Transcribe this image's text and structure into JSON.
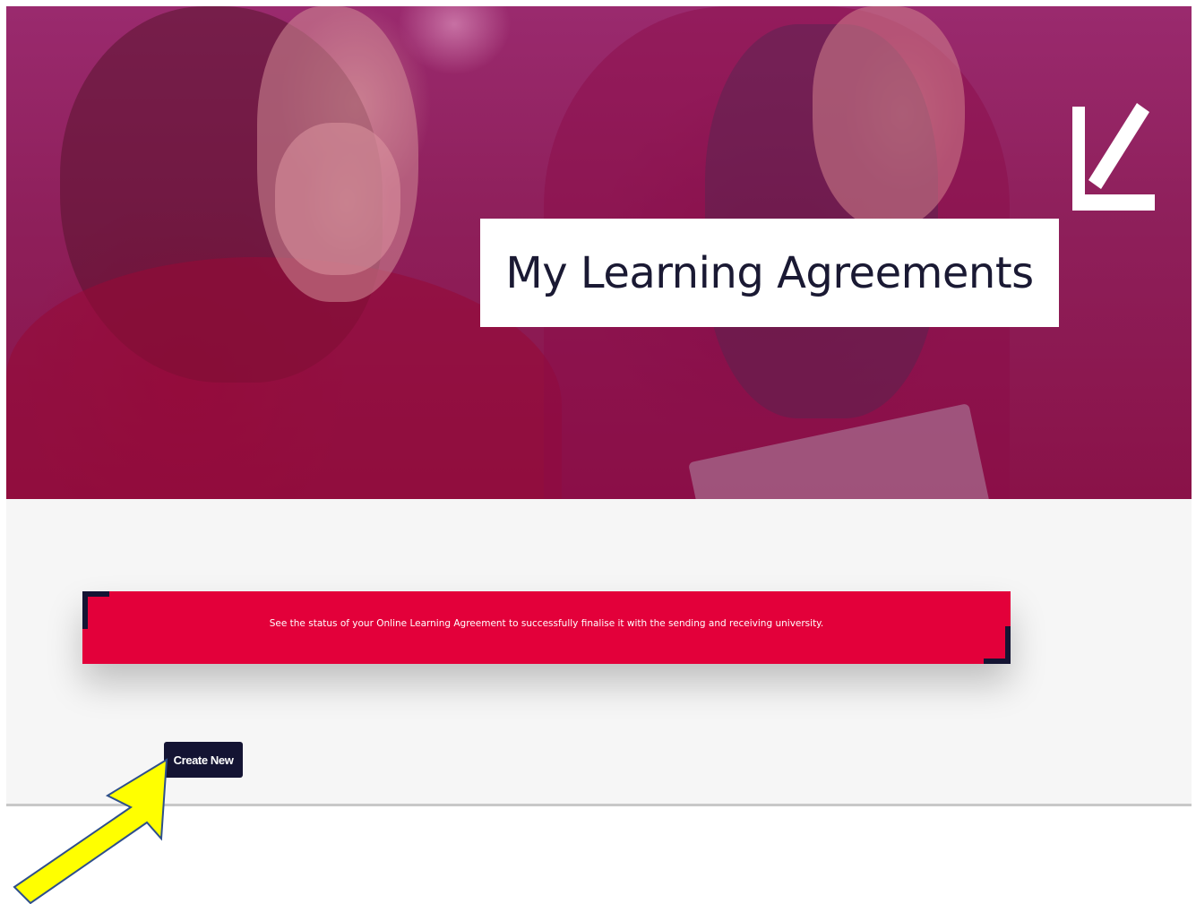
{
  "hero": {
    "title": "My Learning Agreements"
  },
  "notice": {
    "text": "See the status of your Online Learning Agreement to successfully finalise it with the sending and receiving university."
  },
  "actions": {
    "create_new_label": "Create New"
  },
  "colors": {
    "brand_red": "#e3003a",
    "brand_navy": "#141433",
    "hero_overlay": "#8e1f5a",
    "arrow_yellow": "#ffff00"
  },
  "icons": {
    "corner_logo": "corner-arrow-logo-icon",
    "callout": "pointer-arrow-icon"
  }
}
